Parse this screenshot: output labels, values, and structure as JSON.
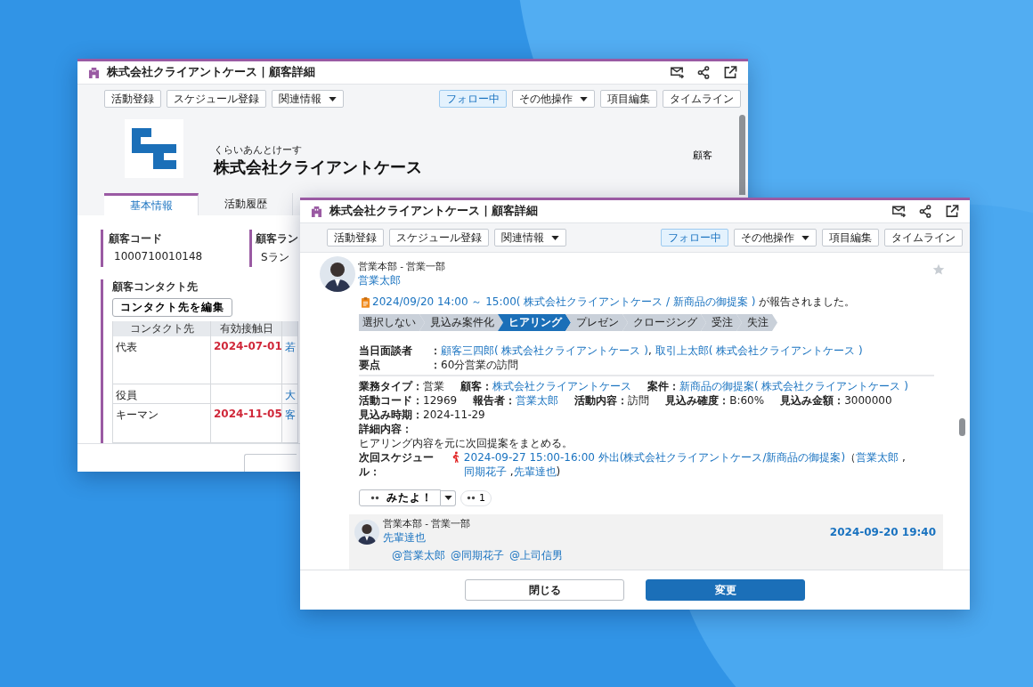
{
  "back_window": {
    "title": "株式会社クライアントケース | 顧客詳細",
    "toolbar_left": [
      {
        "label": "活動登録",
        "kind": "button",
        "on": false
      },
      {
        "label": "スケジュール登録",
        "kind": "button",
        "on": false
      },
      {
        "label": "関連情報",
        "kind": "menu",
        "on": false
      }
    ],
    "toolbar_right": [
      {
        "label": "フォロー中",
        "kind": "toggle",
        "on": true
      },
      {
        "label": "その他操作",
        "kind": "menu",
        "on": false
      },
      {
        "label": "項目編集",
        "kind": "button",
        "on": false
      },
      {
        "label": "タイムライン",
        "kind": "button",
        "on": false
      }
    ],
    "company": {
      "furigana": "くらいあんとけーす",
      "name": "株式会社クライアントケース",
      "type_label": "顧客"
    },
    "tabs": [
      {
        "label": "基本情報",
        "selected": true
      },
      {
        "label": "活動履歴",
        "selected": false
      }
    ],
    "fields": [
      {
        "label": "顧客コード",
        "value": "1000710010148"
      },
      {
        "label": "顧客ラン",
        "value": "Sラン"
      }
    ],
    "contacts": {
      "title": "顧客コンタクト先",
      "edit_button": "コンタクト先を編集",
      "columns": [
        "コンタクト先",
        "有効接触日"
      ],
      "rows": [
        {
          "name": "代表",
          "date": "2024-07-01",
          "column_3": "若"
        },
        {
          "name": "役員",
          "date": "",
          "column_3": "大"
        },
        {
          "name": "キーマン",
          "date": "2024-11-05",
          "column_3": "客"
        }
      ]
    }
  },
  "front_window": {
    "title": "株式会社クライアントケース | 顧客詳細",
    "toolbar_left": [
      {
        "label": "活動登録",
        "kind": "button",
        "on": false
      },
      {
        "label": "スケジュール登録",
        "kind": "button",
        "on": false
      },
      {
        "label": "関連情報",
        "kind": "menu",
        "on": false
      }
    ],
    "toolbar_right": [
      {
        "label": "フォロー中",
        "kind": "toggle",
        "on": true
      },
      {
        "label": "その他操作",
        "kind": "menu",
        "on": false
      },
      {
        "label": "項目編集",
        "kind": "button",
        "on": false
      },
      {
        "label": "タイムライン",
        "kind": "button",
        "on": false
      }
    ],
    "post": {
      "department": "営業本部 - 営業一部",
      "author": "営業太郎",
      "starred": false,
      "report": {
        "link": "2024/09/20 14:00 ～ 15:00( 株式会社クライアントケース / 新商品の御提案 )",
        "suffix": " が報告されました。"
      },
      "stages": [
        {
          "label": "選択しない",
          "selected": false
        },
        {
          "label": "見込み案件化",
          "selected": false
        },
        {
          "label": "ヒアリング",
          "selected": true
        },
        {
          "label": "プレゼン",
          "selected": false
        },
        {
          "label": "クロージング",
          "selected": false
        },
        {
          "label": "受注",
          "selected": false
        },
        {
          "label": "失注",
          "selected": false
        }
      ],
      "summary": [
        {
          "label": "当日面談者",
          "sep": "：",
          "parts": [
            {
              "text": "顧客三四郎( 株式会社クライアントケース )",
              "link": true
            },
            {
              "text": ", ",
              "link": false
            },
            {
              "text": "取引上太郎( 株式会社クライアントケース )",
              "link": true
            }
          ]
        },
        {
          "label": "要点",
          "sep": "：",
          "parts": [
            {
              "text": "60分営業の訪問",
              "link": false
            }
          ]
        }
      ],
      "meta_rows": [
        [
          {
            "label": "業務タイプ：",
            "value": "営業",
            "link": false
          },
          {
            "label": "顧客：",
            "value": "株式会社クライアントケース",
            "link": true
          },
          {
            "label": "案件：",
            "value": "新商品の御提案( 株式会社クライアントケース )",
            "link": true
          }
        ],
        [
          {
            "label": "活動コード：",
            "value": "12969",
            "link": false
          },
          {
            "label": "報告者：",
            "value": "営業太郎",
            "link": true
          },
          {
            "label": "活動内容：",
            "value": "訪問",
            "link": false
          },
          {
            "label": "見込み確度：",
            "value": "B:60%",
            "link": false
          },
          {
            "label": "見込み金額：",
            "value": "3000000",
            "link": false
          }
        ],
        [
          {
            "label": "見込み時期：",
            "value": "2024-11-29",
            "link": false
          }
        ]
      ],
      "detail_label": "詳細内容：",
      "detail_text": "ヒアリング内容を元に次回提案をまとめる。",
      "schedule": {
        "label": "次回スケジュール：",
        "parts": [
          {
            "text": "2024-09-27 15:00-16:00 外出(株式会社クライアントケース/新商品の御提案)",
            "link": true
          },
          {
            "text": "（",
            "link": false
          },
          {
            "text": "営業太郎",
            "link": true
          },
          {
            "text": " ,",
            "link": false
          },
          {
            "text": "同期花子",
            "link": true
          },
          {
            "text": " ,",
            "link": false
          },
          {
            "text": "先輩達也",
            "link": true
          },
          {
            "text": ")",
            "link": false
          }
        ]
      },
      "reaction": {
        "label": "みたよ！",
        "count": "1"
      },
      "comment": {
        "department": "営業本部 - 営業一部",
        "author": "先輩達也",
        "time": "2024-09-20 19:40",
        "mentions": [
          "@営業太郎",
          "@同期花子",
          "@上司信男"
        ]
      }
    },
    "footer": [
      {
        "label": "閉じる",
        "kind": "secondary"
      },
      {
        "label": "変更",
        "kind": "primary"
      }
    ]
  }
}
